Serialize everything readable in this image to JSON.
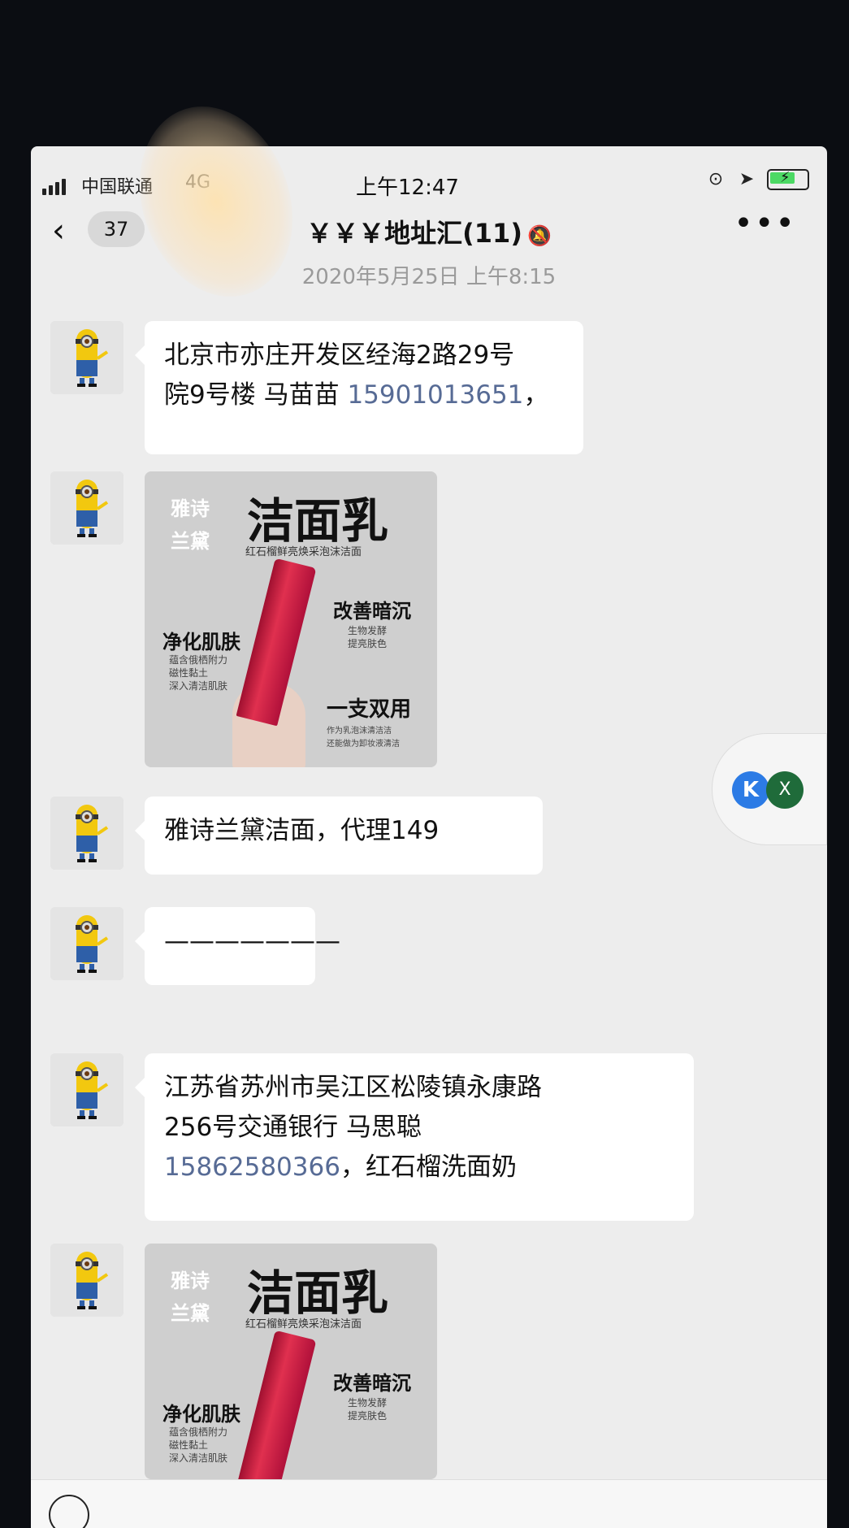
{
  "status_bar": {
    "carrier": "中国联通",
    "network": "4G",
    "time": "上午12:47"
  },
  "nav": {
    "unread_count": "37",
    "title": "￥￥￥地址汇(11)",
    "mute_icon": "bell-slash-icon",
    "more_icon": "more-dots-icon"
  },
  "timestamp": "2020年5月25日 上午8:15",
  "messages": [
    {
      "type": "text",
      "line1": "北京市亦庄开发区经海2路29号",
      "line2_prefix": "院9号楼 马苗苗 ",
      "phone": "15901013651",
      "line2_suffix": "，"
    },
    {
      "type": "image",
      "product": {
        "brand": "雅诗兰黛",
        "brand_line1": "雅诗",
        "brand_line2": "兰黛",
        "title": "洁面乳",
        "subtitle": "红石榴鲜亮焕采泡沫洁面",
        "left_label": "净化肌肤",
        "left_small_1": "蕴含俄栖附力",
        "left_small_2": "磁性黏土",
        "left_small_3": "深入清洁肌肤",
        "right_label_1": "改善暗沉",
        "right_small_1": "生物发酵",
        "right_small_2": "提亮肤色",
        "right_label_2": "一支双用",
        "right_small_3": "作为乳泡沫清洁洁",
        "right_small_4": "还能做为卸妆液清洁"
      }
    },
    {
      "type": "text",
      "text": "雅诗兰黛洁面，代理149"
    },
    {
      "type": "text",
      "text": "———————"
    },
    {
      "type": "text",
      "line1": "江苏省苏州市吴江区松陵镇永康路",
      "line2": "256号交通银行 马思聪",
      "phone": "15862580366",
      "line3_suffix": "，红石榴洗面奶"
    },
    {
      "type": "image",
      "product": {
        "brand_line1": "雅诗",
        "brand_line2": "兰黛",
        "title": "洁面乳",
        "subtitle": "红石榴鲜亮焕采泡沫洁面",
        "left_label": "净化肌肤",
        "left_small_1": "蕴含俄栖附力",
        "left_small_2": "磁性黏土",
        "left_small_3": "深入清洁肌肤",
        "right_label_1": "改善暗沉",
        "right_small_1": "生物发酵",
        "right_small_2": "提亮肤色"
      }
    }
  ],
  "floating_widget": {
    "k_label": "K",
    "x_label": "X"
  },
  "colors": {
    "chat_bg": "#ededed",
    "bubble_bg": "#ffffff",
    "link": "#576b95",
    "timestamp": "#9a9a9a"
  }
}
